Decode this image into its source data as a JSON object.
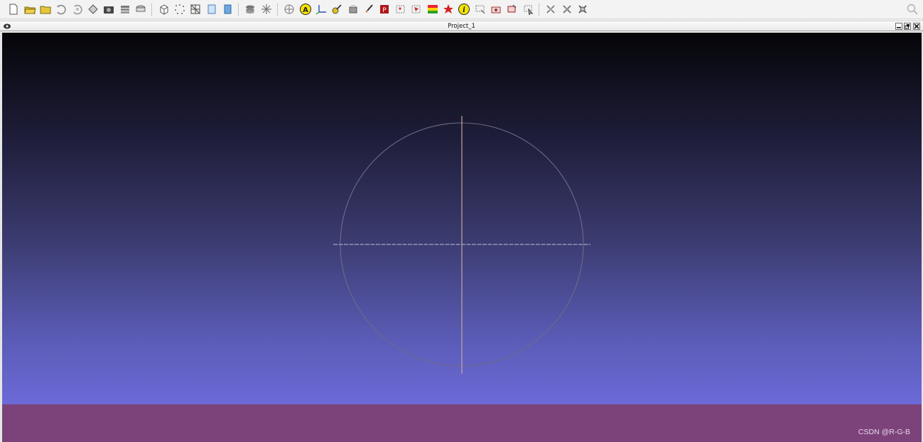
{
  "toolbar": {
    "groups": [
      [
        {
          "name": "new-project-icon",
          "icon": "page"
        },
        {
          "name": "open-project-icon",
          "icon": "folder-open"
        },
        {
          "name": "import-mesh-icon",
          "icon": "folder"
        },
        {
          "name": "reload-icon",
          "icon": "reload"
        },
        {
          "name": "reload-all-icon",
          "icon": "reload-all"
        },
        {
          "name": "export-mesh-icon",
          "icon": "diamond"
        },
        {
          "name": "snapshot-icon",
          "icon": "camera"
        },
        {
          "name": "layer-stack-icon",
          "icon": "stack"
        },
        {
          "name": "raster-icon",
          "icon": "disk"
        }
      ],
      [
        {
          "name": "bounding-box-icon",
          "icon": "cube"
        },
        {
          "name": "points-icon",
          "icon": "dots"
        },
        {
          "name": "wireframe-icon",
          "icon": "wire"
        },
        {
          "name": "flat-shading-icon",
          "icon": "flat"
        },
        {
          "name": "smooth-shading-icon",
          "icon": "smooth"
        }
      ],
      [
        {
          "name": "layers-dialog-icon",
          "icon": "layers"
        },
        {
          "name": "light-icon",
          "icon": "light"
        }
      ],
      [
        {
          "name": "trackball-icon",
          "icon": "trackball"
        },
        {
          "name": "annotation-icon",
          "icon": "a-circle"
        },
        {
          "name": "axes-icon",
          "icon": "axes"
        },
        {
          "name": "measure-icon",
          "icon": "measure"
        },
        {
          "name": "paint-bucket-icon",
          "icon": "bucket"
        },
        {
          "name": "brush-icon",
          "icon": "brush"
        },
        {
          "name": "texture-paint-icon",
          "icon": "tex"
        },
        {
          "name": "select-vertices-icon",
          "icon": "selv"
        },
        {
          "name": "select-faces-icon",
          "icon": "self"
        },
        {
          "name": "color-map-icon",
          "icon": "colormap"
        },
        {
          "name": "georef-icon",
          "icon": "georef"
        },
        {
          "name": "info-icon",
          "icon": "info"
        },
        {
          "name": "select-region-icon",
          "icon": "selr"
        },
        {
          "name": "select-connected-icon",
          "icon": "selc"
        },
        {
          "name": "select-point-icon",
          "icon": "selp"
        },
        {
          "name": "select-cursor-icon",
          "icon": "selcur"
        }
      ],
      [
        {
          "name": "delete-vertices-icon",
          "icon": "xv"
        },
        {
          "name": "delete-faces-icon",
          "icon": "xf"
        },
        {
          "name": "delete-all-icon",
          "icon": "xa"
        }
      ]
    ],
    "search_icon": "search-icon"
  },
  "window": {
    "title": "Project_1"
  },
  "viewport": {
    "background_top": "#050508",
    "background_bottom": "#6c6ad8",
    "band_color": "#7b4379",
    "trackball_color": "#77708c",
    "watermark": "CSDN @R-G-B"
  }
}
